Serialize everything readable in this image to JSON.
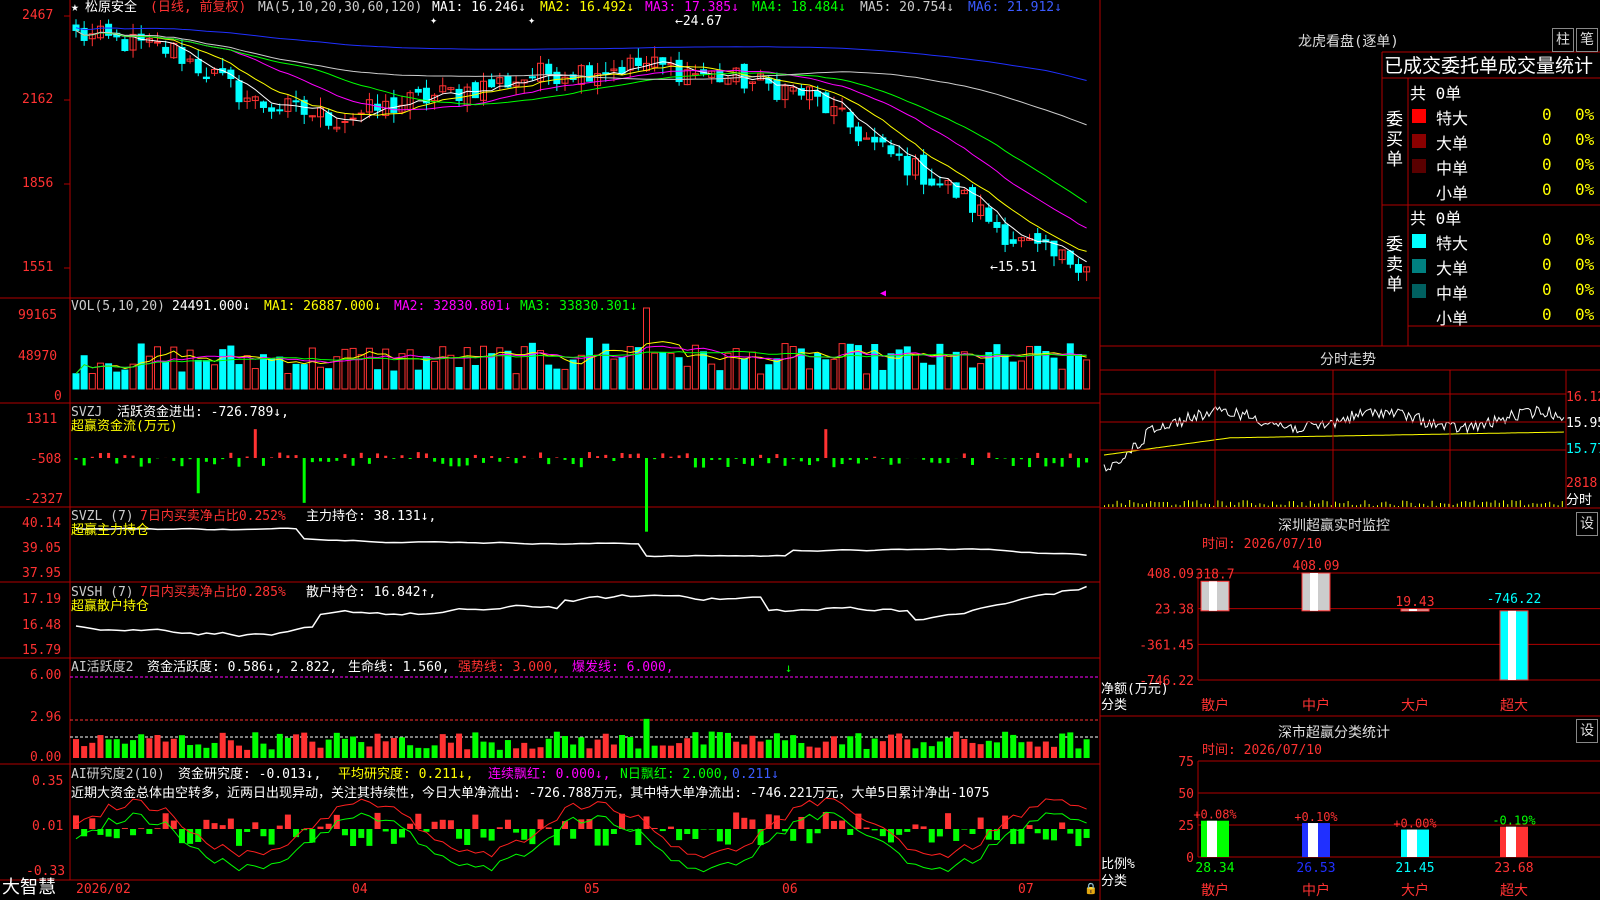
{
  "app_logo": "大智慧",
  "stock": {
    "header_star": "★",
    "name": "松原安全",
    "period": "(日线, 前复权)",
    "ma_label": "MA(5,10,20,30,60,120)",
    "ma1": "MA1: 16.246↓",
    "ma2": "MA2: 16.492↓",
    "ma3": "MA3: 17.385↓",
    "ma4": "MA4: 18.484↓",
    "ma5": "MA5: 20.754↓",
    "ma6": "MA6: 21.912↓",
    "high_marker": "←24.67",
    "low_marker": "←15.51"
  },
  "axes": {
    "price_ticks": [
      "2467",
      "2162",
      "1856",
      "1551"
    ],
    "vol_ticks": [
      "99165",
      "48970",
      "0"
    ],
    "svzj_ticks": [
      "1311",
      "-508",
      "-2327"
    ],
    "svzl_ticks": [
      "40.14",
      "39.05",
      "37.95"
    ],
    "svsh_ticks": [
      "17.19",
      "16.48",
      "15.79"
    ],
    "ai_ticks": [
      "6.00",
      "2.96",
      "0.00"
    ],
    "ai2_ticks": [
      "0.35",
      "0.01",
      "-0.33"
    ],
    "date_labels": [
      "2026/02",
      "04",
      "05",
      "06",
      "07"
    ]
  },
  "panels": {
    "vol": {
      "label": "VOL(5,10,20)",
      "value": "24491.000↓",
      "ma1": "MA1: 26887.000↓",
      "ma2": "MA2: 32830.801↓",
      "ma3": "MA3: 33830.301↓"
    },
    "svzj": {
      "label": "SVZJ",
      "flow": "活跃资金进出: -726.789↓,",
      "title": "超赢资金流(万元)"
    },
    "svzl": {
      "label": "SVZL (7)",
      "ratio": "7日内买卖净占比0.252%",
      "hold": "主力持仓: 38.131↓,",
      "title": "超赢主力持仓"
    },
    "svsh": {
      "label": "SVSH (7)",
      "ratio": "7日内买卖净占比0.285%",
      "hold": "散户持仓: 16.842↑,",
      "title": "超赢散户持仓"
    },
    "ai": {
      "label": "AI活跃度2",
      "activity": "资金活跃度: 0.586↓, 2.822,",
      "life": "生命线: 1.560,",
      "strong": "强势线: 3.000,",
      "burst": "爆发线: 6.000,"
    },
    "ai2": {
      "label": "AI研究度2(10)",
      "research": "资金研究度: -0.013↓,",
      "avg": "平均研究度: 0.211↓,",
      "cont": "连续飘红: 0.000↓,",
      "nday": "N日飘红: 2.000,",
      "nval": "0.211↓",
      "note": "近期大资金总体由空转多，近两日出现异动，关注其持续性，今日大单净流出: -726.788万元，其中特大单净流出: -746.221万元，大单5日累计净出-1075"
    }
  },
  "right": {
    "dragon_title": "龙虎看盘(逐单)",
    "btn_zhu": "柱",
    "btn_bi": "笔",
    "stat_title": "已成交委托单成交量统计",
    "buy_label": "委买单",
    "sell_label": "委卖单",
    "buy_total": "共 0单",
    "sell_total": "共 0单",
    "buy_rows": [
      {
        "name": "特大",
        "count": "0",
        "pct": "0%",
        "color": "#ff0000"
      },
      {
        "name": "大单",
        "count": "0",
        "pct": "0%",
        "color": "#8b0000"
      },
      {
        "name": "中单",
        "count": "0",
        "pct": "0%",
        "color": "#5a0000"
      },
      {
        "name": "小单",
        "count": "0",
        "pct": "0%",
        "color": "#000000"
      }
    ],
    "sell_rows": [
      {
        "name": "特大",
        "count": "0",
        "pct": "0%",
        "color": "#00ffff"
      },
      {
        "name": "大单",
        "count": "0",
        "pct": "0%",
        "color": "#008080"
      },
      {
        "name": "中单",
        "count": "0",
        "pct": "0%",
        "color": "#006060"
      },
      {
        "name": "小单",
        "count": "0",
        "pct": "0%",
        "color": "#000000"
      }
    ],
    "intraday_title": "分时走势",
    "intraday_ticks": [
      "16.12",
      "15.95",
      "15.77"
    ],
    "intraday_vol": "2818",
    "intraday_vol_label": "分时",
    "monitor_title": "深圳超赢实时监控",
    "monitor_time": "时间: 2026/07/10",
    "monitor_btn": "设",
    "monitor_ticks": [
      "408.09",
      "23.38",
      "-361.45",
      "-746.22"
    ],
    "monitor_ylabel": "净额(万元)",
    "monitor_xlabel": "分类",
    "categories": [
      "散户",
      "中户",
      "大户",
      "超大"
    ],
    "monitor_values": [
      "318.7",
      "408.09",
      "19.43",
      "-746.22"
    ],
    "class_title": "深市超赢分类统计",
    "class_time": "时间: 2026/07/10",
    "class_btn": "设",
    "class_ticks": [
      "75",
      "50",
      "25",
      "0"
    ],
    "class_ylabel": "比例%",
    "class_xlabel": "分类",
    "class_changes": [
      "+0.08%",
      "+0.10%",
      "+0.00%",
      "-0.19%"
    ],
    "class_values": [
      "28.34",
      "26.53",
      "21.45",
      "23.68"
    ]
  },
  "chart_data": [
    {
      "type": "bar",
      "title": "深圳超赢实时监控",
      "categories": [
        "散户",
        "中户",
        "大户",
        "超大"
      ],
      "values": [
        318.7,
        408.09,
        19.43,
        -746.22
      ],
      "ylim": [
        -746.22,
        408.09
      ],
      "ylabel": "净额(万元)",
      "xlabel": "分类"
    },
    {
      "type": "bar",
      "title": "深市超赢分类统计",
      "categories": [
        "散户",
        "中户",
        "大户",
        "超大"
      ],
      "values": [
        28.34,
        26.53,
        21.45,
        23.68
      ],
      "ylim": [
        0,
        75
      ],
      "ylabel": "比例%",
      "xlabel": "分类"
    }
  ],
  "colors": {
    "up": "#ff3232",
    "down": "#00ffff",
    "grid": "#b00000",
    "ma1": "#ffffff",
    "ma2": "#ffff00",
    "ma3": "#ff00ff",
    "ma4": "#00ff00",
    "ma5": "#cccccc",
    "ma6": "#2030ff"
  }
}
